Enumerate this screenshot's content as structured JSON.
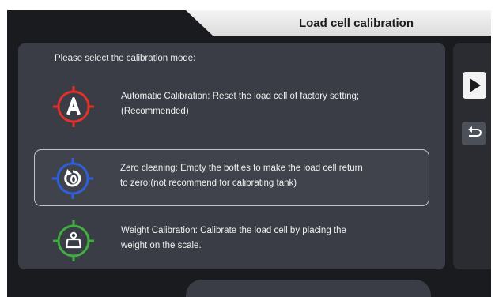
{
  "header": {
    "title": "Load cell calibration"
  },
  "panel": {
    "prompt": "Please select the calibration mode:",
    "options": [
      {
        "text": "Automatic Calibration:  Reset the load cell of factory setting;\n(Recommended)",
        "icon": "letter-a-target-icon",
        "color": "#e2302b",
        "selected": false
      },
      {
        "text": "Zero cleaning: Empty the bottles to make the load cell return\nto zero;(not recommend for calibrating tank)",
        "icon": "zero-reset-target-icon",
        "color": "#2f5fd8",
        "selected": true
      },
      {
        "text": "Weight Calibration: Calibrate the load cell by placing the\nweight on the scale.",
        "icon": "weight-target-icon",
        "color": "#3fae3f",
        "selected": false
      }
    ]
  },
  "sidebar": {
    "next_icon": "play-icon",
    "back_icon": "return-icon"
  }
}
